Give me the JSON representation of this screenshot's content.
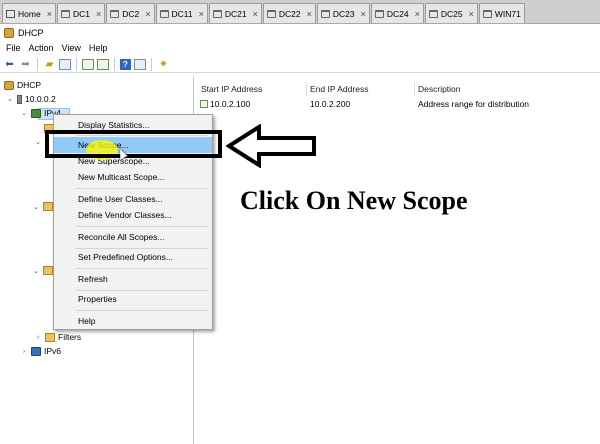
{
  "tabs": [
    {
      "label": "Home",
      "icon": "home-icon",
      "active": false
    },
    {
      "label": "DC1",
      "icon": "vm-icon",
      "active": false
    },
    {
      "label": "DC2",
      "icon": "vm-icon",
      "active": false
    },
    {
      "label": "DC11",
      "icon": "vm-icon",
      "active": false
    },
    {
      "label": "DC21",
      "icon": "vm-icon",
      "active": false
    },
    {
      "label": "DC22",
      "icon": "vm-icon",
      "active": false
    },
    {
      "label": "DC23",
      "icon": "vm-icon",
      "active": false
    },
    {
      "label": "DC24",
      "icon": "vm-icon",
      "active": false
    },
    {
      "label": "DC25",
      "icon": "vm-icon",
      "active": false
    },
    {
      "label": "WIN71",
      "icon": "vm-icon",
      "active": false
    }
  ],
  "window": {
    "title": "DHCP"
  },
  "menu": {
    "file": "File",
    "action": "Action",
    "view": "View",
    "help": "Help"
  },
  "toolbar": {
    "icons": [
      "back-arrow-icon",
      "forward-arrow-icon",
      "up-folder-icon",
      "show-hide-tree-icon",
      "export-list-icon",
      "properties-icon",
      "help-icon",
      "action-pane-icon",
      "settings-star-icon"
    ]
  },
  "tree": {
    "root": "DHCP",
    "server": "10.0.0.2",
    "ipv4": "IPv4",
    "filters": "Filters",
    "ipv6": "IPv6"
  },
  "list": {
    "columns": [
      "Start IP Address",
      "End IP Address",
      "Description"
    ],
    "rows": [
      {
        "start": "10.0.2.100",
        "end": "10.0.2.200",
        "description": "Address range for distribution"
      }
    ]
  },
  "context_menu": {
    "items": [
      "Display Statistics...",
      "New Scope...",
      "New Superscope...",
      "New Multicast Scope...",
      "Define User Classes...",
      "Define Vendor Classes...",
      "Reconcile All Scopes...",
      "Set Predefined Options...",
      "Refresh",
      "Properties",
      "Help"
    ],
    "highlighted": "New Scope..."
  },
  "annotation": {
    "text": "Click On New Scope",
    "highlight_color": "#fff700",
    "box_color": "#000000"
  },
  "colors": {
    "menu_highlight": "#91c9f7",
    "tree_selection": "#cde2f7",
    "tab_strip": "#cfcfcf"
  }
}
